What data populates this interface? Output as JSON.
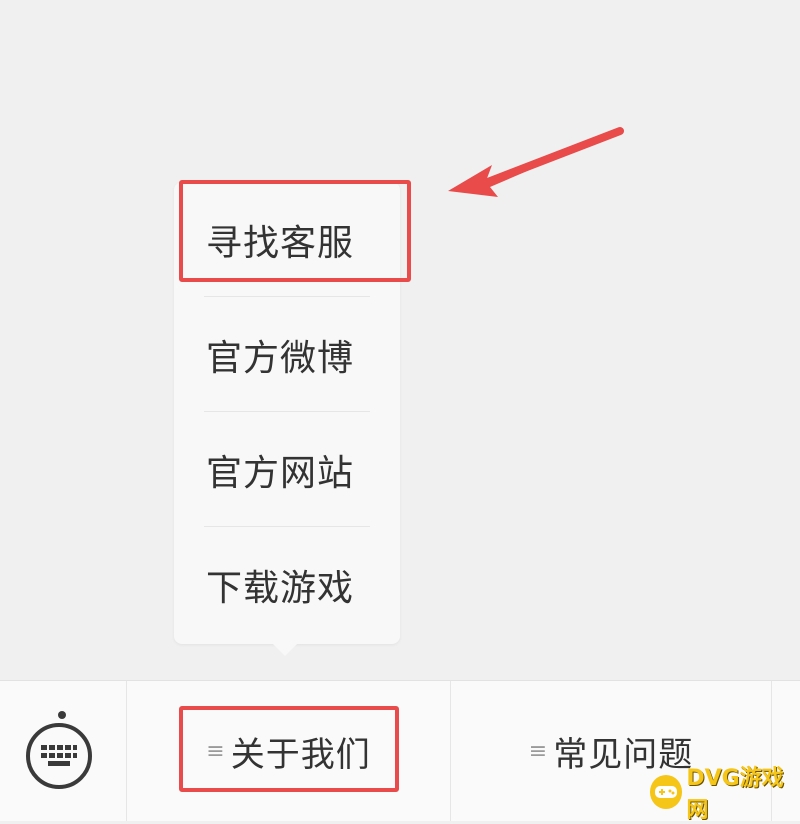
{
  "popup_menu": {
    "items": [
      {
        "label": "寻找客服",
        "highlighted": true
      },
      {
        "label": "官方微博",
        "highlighted": false
      },
      {
        "label": "官方网站",
        "highlighted": false
      },
      {
        "label": "下载游戏",
        "highlighted": false
      }
    ]
  },
  "bottom_bar": {
    "keyboard_icon": "keyboard-icon",
    "tabs": [
      {
        "label": "关于我们",
        "menu_icon": "≡",
        "highlighted": true
      },
      {
        "label": "常见问题",
        "menu_icon": "≡",
        "highlighted": false
      }
    ]
  },
  "annotation": {
    "color": "#e94a4a"
  },
  "watermark": {
    "text": "DVG游戏网"
  }
}
